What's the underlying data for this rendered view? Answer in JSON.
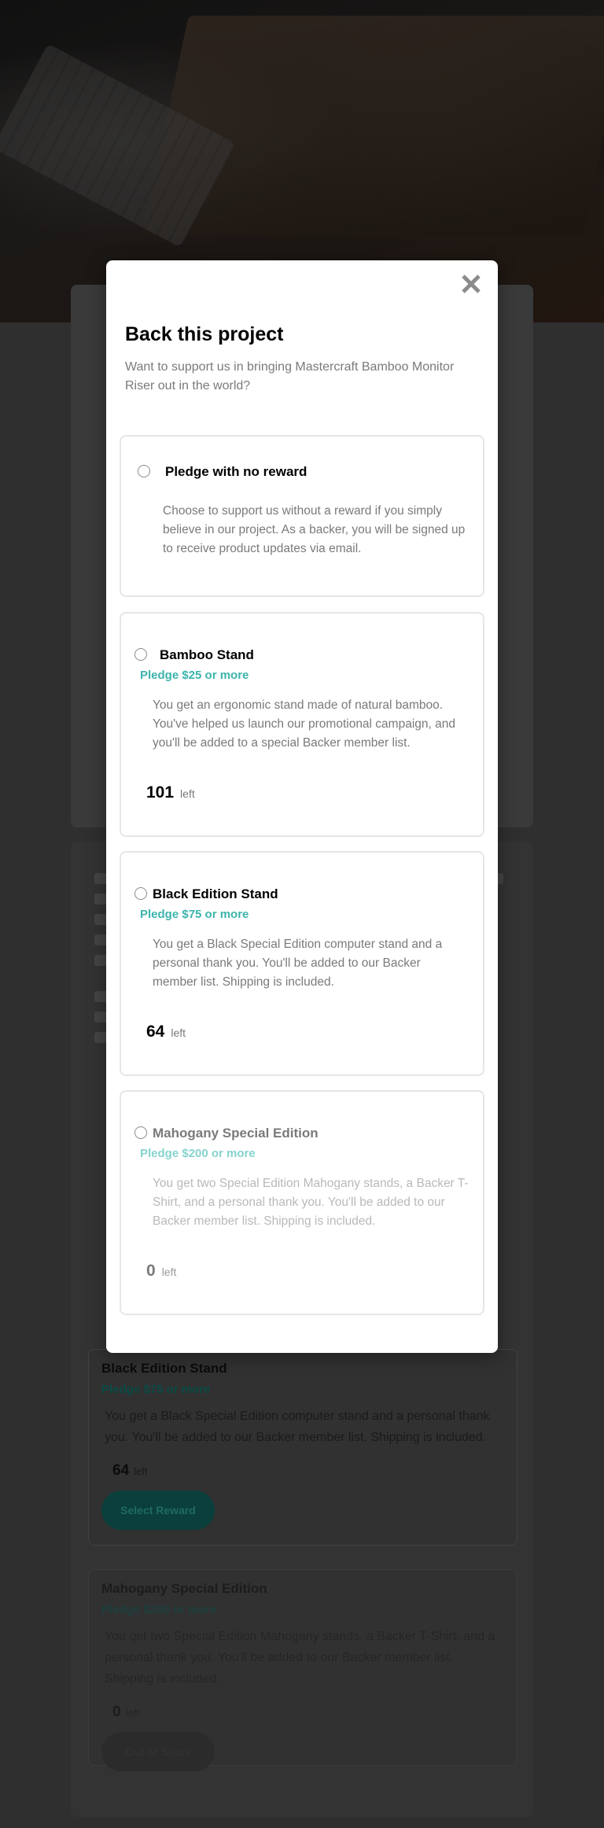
{
  "background": {
    "rewards": [
      {
        "title": "Black Edition Stand",
        "pledge": "Pledge $75 or more",
        "description": "You get a Black Special Edition computer stand and a personal thank you. You'll be added to our Backer member list. Shipping is included.",
        "left_count": "64",
        "left_label": "left",
        "button": "Select Reward"
      },
      {
        "title": "Mahogany Special Edition",
        "pledge": "Pledge $200 or more",
        "description": "You get two Special Edition Mahogany stands, a Backer T-Shirt, and a personal thank you. You'll be added to our Backer member list. Shipping is included.",
        "left_count": "0",
        "left_label": "left",
        "button": "Out of Stock"
      }
    ]
  },
  "modal": {
    "close_icon": "close-icon",
    "title": "Back this project",
    "subtitle": "Want to support us in bringing Mastercraft Bamboo Monitor Riser out in the world?",
    "options": [
      {
        "title": "Pledge with no reward",
        "description": "Choose to support us without a reward if you simply believe in our project. As a backer, you will be signed up to receive product updates via email."
      },
      {
        "title": "Bamboo Stand",
        "pledge": "Pledge $25 or more",
        "description": "You get an ergonomic stand made of natural bamboo. You've helped us launch our promotional campaign, and you'll be added to a special Backer member list.",
        "left_count": "101",
        "left_label": "left"
      },
      {
        "title": "Black Edition Stand",
        "pledge": "Pledge $75 or more",
        "description": "You get a Black Special Edition computer stand and a personal thank you. You'll be added to our Backer member list. Shipping is included.",
        "left_count": "64",
        "left_label": "left"
      },
      {
        "title": "Mahogany Special Edition",
        "pledge": "Pledge $200 or more",
        "description": "You get two Special Edition Mahogany stands, a Backer T-Shirt, and a personal thank you. You'll be added to our Backer member list. Shipping is included.",
        "left_count": "0",
        "left_label": "left"
      }
    ]
  },
  "colors": {
    "accent": "#3cb4ac",
    "accent_dark": "#147a70",
    "overlay": "rgba(0,0,0,0.5)"
  }
}
